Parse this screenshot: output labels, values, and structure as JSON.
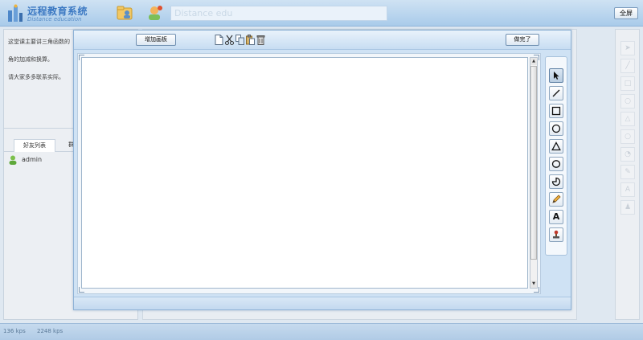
{
  "header": {
    "logo_title": "远程教育系统",
    "logo_subtitle": "Distance education",
    "field_text": "Distance edu",
    "fullscreen_label": "全屏"
  },
  "sidebar": {
    "notice_lines": [
      "这堂课主要讲三角函数的",
      "角的加减和换算。",
      "请大家多多联系实际。"
    ],
    "tabs": [
      "好友列表",
      "群"
    ],
    "friends": [
      {
        "name": "admin"
      }
    ]
  },
  "whiteboard": {
    "add_board_label": "增加画板",
    "done_label": "做完了",
    "toolbar_icons": [
      "new-page-icon",
      "cut-icon",
      "copy-icon",
      "paste-icon",
      "delete-icon"
    ],
    "tools": [
      {
        "name": "select",
        "icon": "pointer-arrow-icon",
        "active": true
      },
      {
        "name": "line",
        "icon": "line-icon"
      },
      {
        "name": "rectangle",
        "icon": "rectangle-icon"
      },
      {
        "name": "circle",
        "icon": "circle-icon"
      },
      {
        "name": "triangle",
        "icon": "triangle-icon"
      },
      {
        "name": "ellipse",
        "icon": "ellipse-icon"
      },
      {
        "name": "arc",
        "icon": "arc-icon"
      },
      {
        "name": "pencil",
        "icon": "pencil-icon"
      },
      {
        "name": "text",
        "icon": "text-icon",
        "glyph": "A"
      },
      {
        "name": "stamp",
        "icon": "stamp-icon"
      }
    ]
  },
  "status": {
    "upload_rate": "136 kps",
    "download_rate": "2248 kps"
  },
  "colors": {
    "accent": "#3b78c2",
    "header_bg": "#a9cbea",
    "dialog_bg": "#cfe2f4"
  }
}
